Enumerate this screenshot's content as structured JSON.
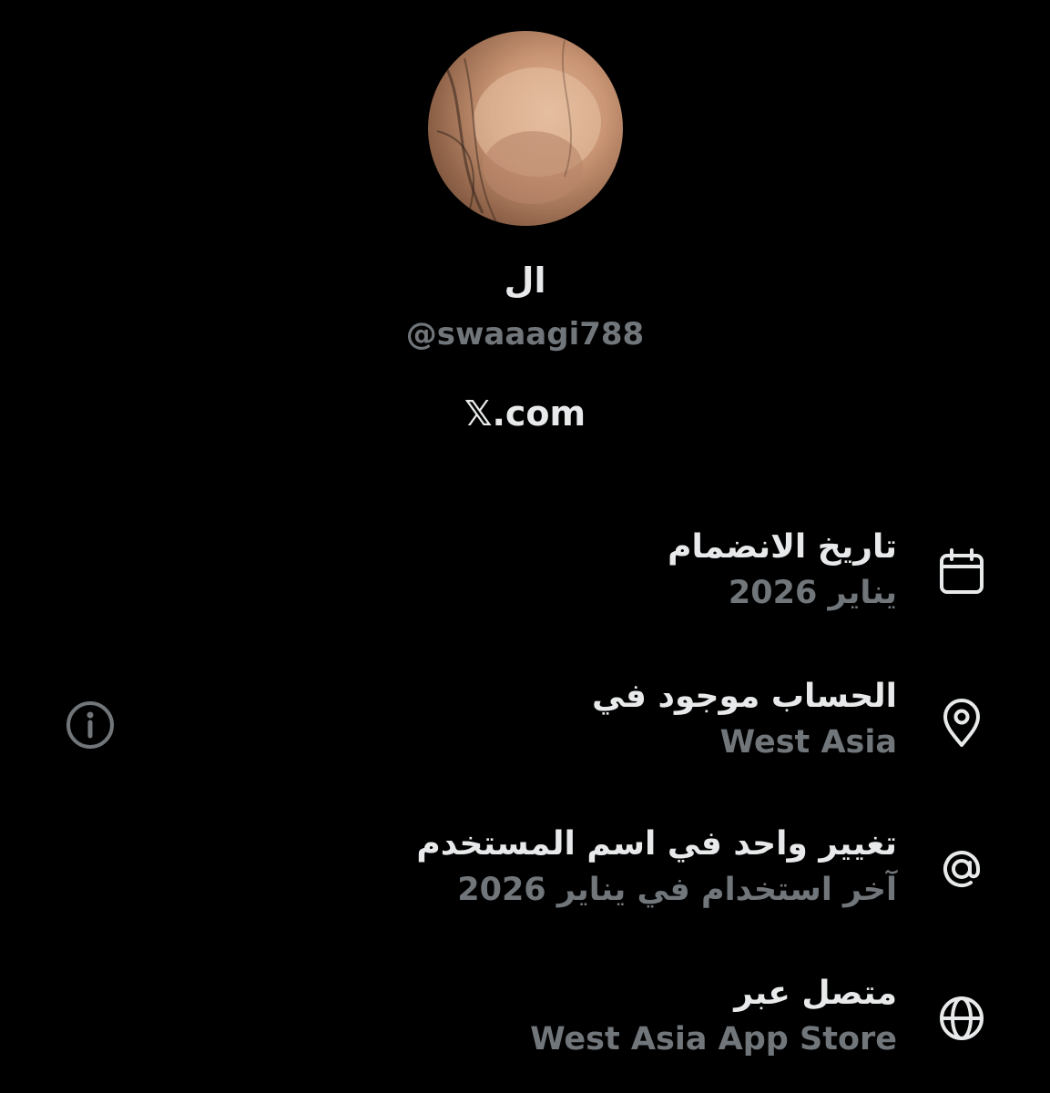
{
  "profile": {
    "display_name": "ال",
    "handle": "@swaaagi788",
    "source": "𝕏.com"
  },
  "rows": [
    {
      "icon": "calendar-icon",
      "title": "تاريخ الانضمام",
      "value": "يناير 2026"
    },
    {
      "icon": "location-pin-icon",
      "title": "الحساب موجود في",
      "value": "West Asia"
    },
    {
      "icon": "at-sign-icon",
      "title": "تغيير واحد في اسم المستخدم",
      "value": "آخر استخدام في يناير 2026"
    },
    {
      "icon": "globe-icon",
      "title": "متصل عبر",
      "value": "West Asia App Store"
    }
  ],
  "info_button_icon": "info-icon",
  "colors": {
    "background": "#000000",
    "primary_text": "#e7e9ea",
    "secondary_text": "#71767b"
  }
}
